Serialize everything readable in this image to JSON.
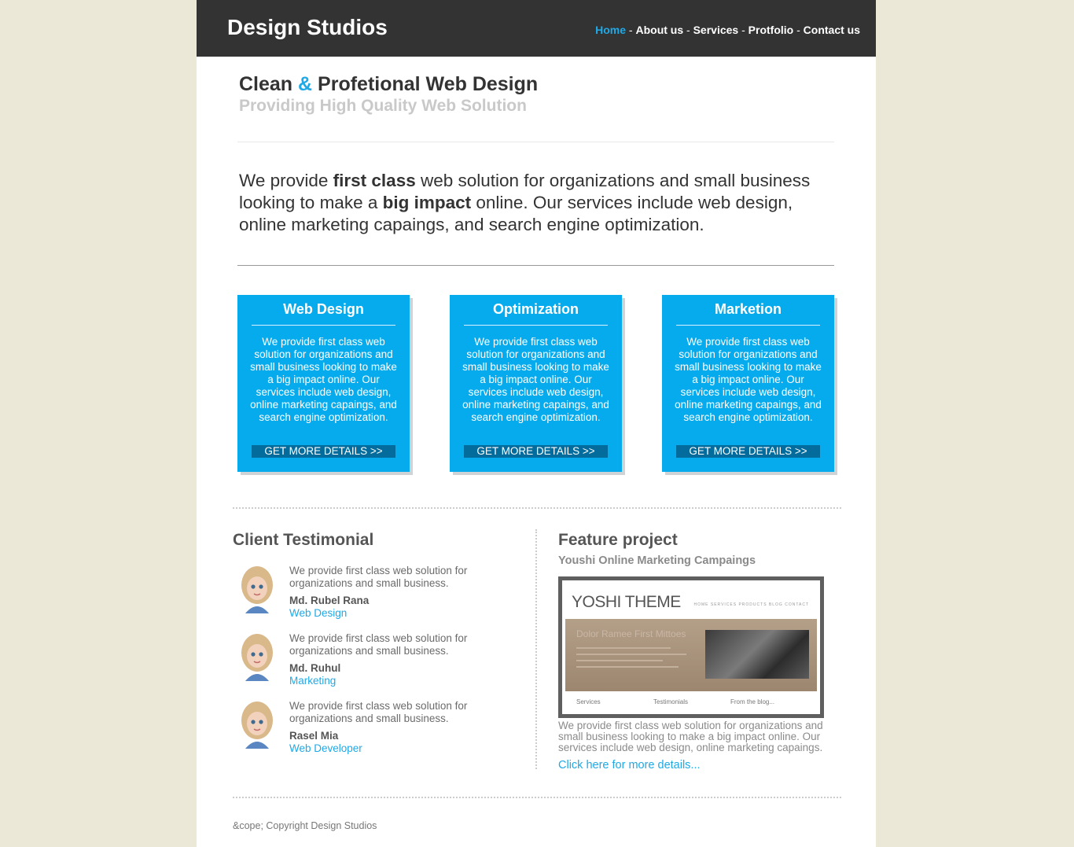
{
  "brand": "Design Studios",
  "nav": {
    "items": [
      "Home",
      "About us",
      "Services",
      "Protfolio",
      "Contact us"
    ],
    "active": "Home",
    "separator": "-"
  },
  "hero": {
    "title_before": "Clean ",
    "title_amp": "&",
    "title_after": " Profetional Web Design",
    "subtitle": "Providing High Quality Web Solution"
  },
  "intro": {
    "part1": "We provide ",
    "bold1": "first class",
    "part2": " web solution for organizations and small business looking to make a ",
    "bold2": "big impact",
    "part3": " online. Our services include web design, online marketing capaings, and search engine optimization."
  },
  "services": [
    {
      "title": "Web Design",
      "text": "We provide first class web solution for organizations and small business looking to make a big impact online. Our services include web design, online marketing capaings, and search engine optimization.",
      "button": "GET MORE DETAILS >>"
    },
    {
      "title": "Optimization",
      "text": "We provide first class web solution for organizations and small business looking to make a big impact online. Our services include web design, online marketing capaings, and search engine optimization.",
      "button": "GET MORE DETAILS >>"
    },
    {
      "title": "Marketion",
      "text": "We provide first class web solution for organizations and small business looking to make a big impact online. Our services include web design, online marketing capaings, and search engine optimization.",
      "button": "GET MORE DETAILS >>"
    }
  ],
  "testimonials": {
    "heading": "Client Testimonial",
    "items": [
      {
        "text": "We provide first class web solution for organizations and small business.",
        "name": "Md. Rubel Rana",
        "role": "Web Design"
      },
      {
        "text": "We provide first class web solution for organizations and small business.",
        "name": "Md. Ruhul",
        "role": "Marketing"
      },
      {
        "text": "We provide first class web solution for organizations and small business.",
        "name": "Rasel Mia",
        "role": "Web Developer"
      }
    ]
  },
  "feature": {
    "heading": "Feature project",
    "subtitle": "Youshi Online Marketing Campaings",
    "screenshot": {
      "logo": "YOSHI THEME",
      "nav": "HOME  SERVICES  PRODUCTS  BLOG  CONTACT",
      "banner_title": "Dolor Ramee First Mittoes",
      "columns": [
        "Services",
        "Testimonials",
        "From the blog..."
      ]
    },
    "text": "We provide first class web solution for organizations and small business looking to make a big impact online. Our services include web design, online marketing capaings.",
    "link": "Click here for more details..."
  },
  "footer": "&cope; Copyright Design Studios",
  "colors": {
    "accent": "#1fa9e6",
    "box_blue": "#06abee",
    "header_bg": "#333333",
    "page_bg": "#ece8d8"
  }
}
